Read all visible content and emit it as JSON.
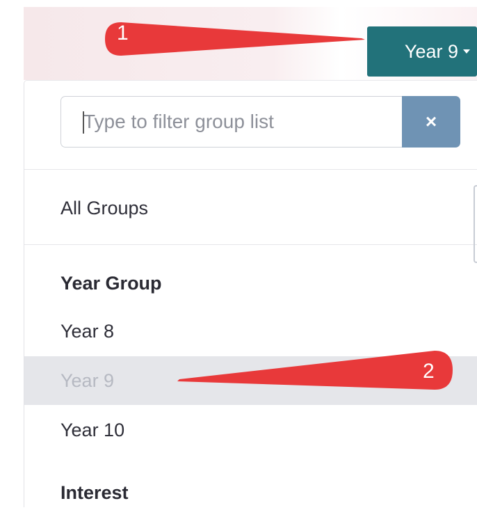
{
  "toolbar": {
    "group_button_label": "Year 9"
  },
  "filter": {
    "placeholder": "Type to filter group list",
    "clear_icon": "×"
  },
  "list": {
    "all_groups": "All Groups",
    "year_group_heading": "Year Group",
    "items": [
      "Year 8",
      "Year 9",
      "Year 10"
    ],
    "selected": "Year 9",
    "interest_heading": "Interest"
  },
  "annotations": {
    "callout_1": "1",
    "callout_2": "2",
    "callout_color": "#e8393a"
  },
  "colors": {
    "button": "#22727a",
    "clear_button": "#6f93b4",
    "selected_row": "#e5e6ea"
  }
}
